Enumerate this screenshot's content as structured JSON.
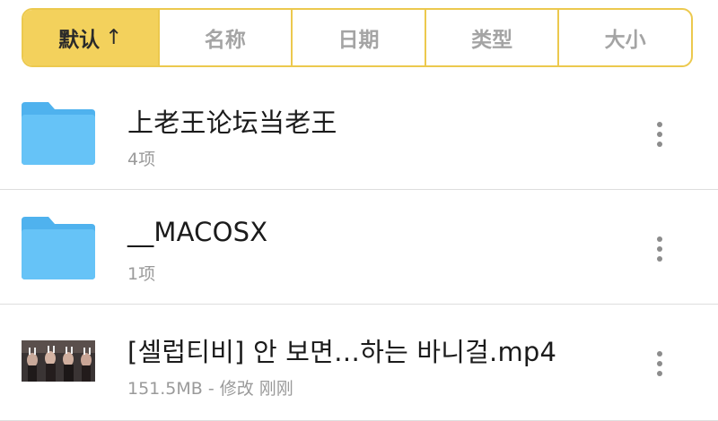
{
  "sort_bar": {
    "tabs": [
      {
        "label": "默认",
        "active": true,
        "arrow": "↑"
      },
      {
        "label": "名称",
        "active": false
      },
      {
        "label": "日期",
        "active": false
      },
      {
        "label": "类型",
        "active": false
      },
      {
        "label": "大小",
        "active": false
      }
    ],
    "accent_color": "#f3d15c",
    "border_color": "#ecc94e"
  },
  "files": [
    {
      "icon": "folder-icon",
      "name": "上老王论坛当老王",
      "meta": "4项"
    },
    {
      "icon": "folder-icon",
      "name": "__MACOSX",
      "meta": "1项"
    },
    {
      "icon": "video-thumbnail",
      "name": "[셀럽티비] 안 보면…하는 바니걸.mp4",
      "meta": "151.5MB - 修改 刚刚"
    }
  ],
  "colors": {
    "folder": "#66c3f7",
    "folder_tab": "#4fb2ee",
    "meta_text": "#9a9a9a",
    "divider": "#dedede"
  }
}
